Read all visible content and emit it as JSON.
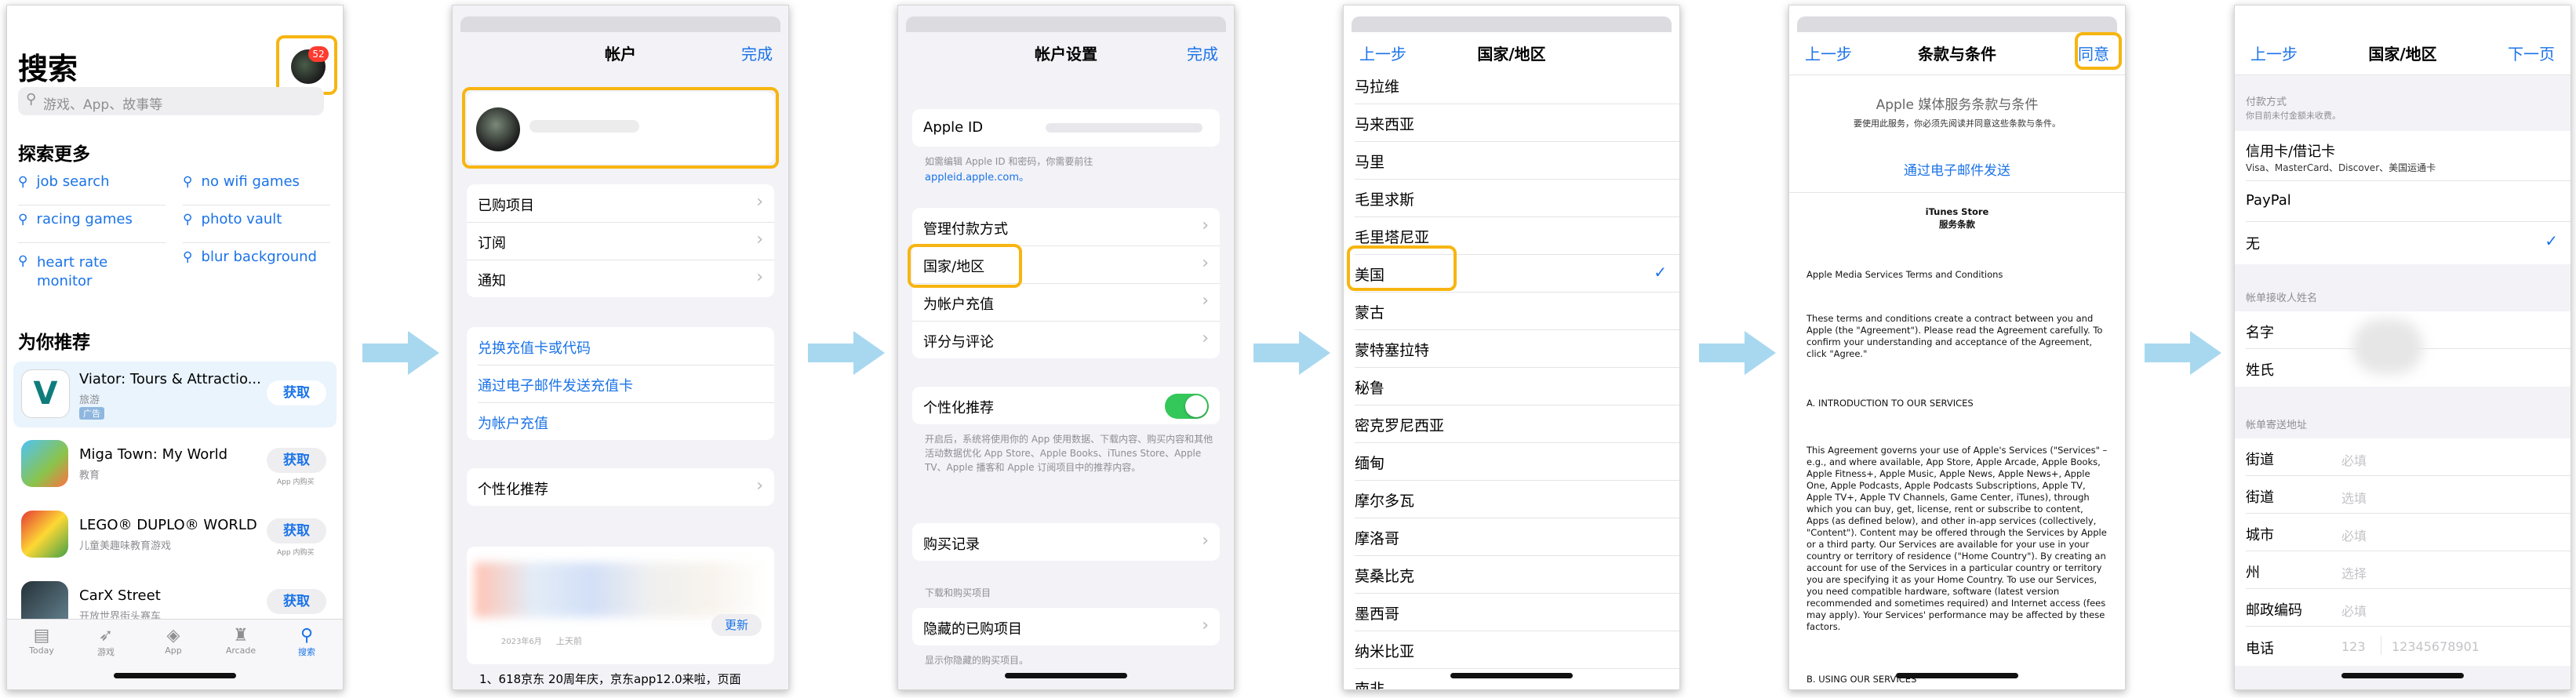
{
  "accent": "#1a73e8",
  "highlight": "#f7b511",
  "arrow_color": "#a8d8f0",
  "s1": {
    "title": "搜索",
    "badge": "52",
    "search_placeholder": "游戏、App、故事等",
    "explore_title": "探索更多",
    "explore": [
      "job search",
      "no wifi games",
      "racing games",
      "photo vault",
      "heart rate monitor",
      "blur background"
    ],
    "rec_title": "为你推荐",
    "apps": [
      {
        "name": "Viator: Tours & Attractio...",
        "cat": "旅游",
        "tag": "广告",
        "btn": "获取",
        "sub": ""
      },
      {
        "name": "Miga Town: My World",
        "cat": "教育",
        "tag": "",
        "btn": "获取",
        "sub": "App 内购买"
      },
      {
        "name": "LEGO® DUPLO® WORLD",
        "cat": "儿童美趣味教育游戏",
        "tag": "",
        "btn": "获取",
        "sub": "App 内购买"
      },
      {
        "name": "CarX Street",
        "cat": "开放世界街头赛车",
        "tag": "",
        "btn": "获取",
        "sub": "App 内购买"
      }
    ],
    "tabs": [
      "Today",
      "游戏",
      "App",
      "Arcade",
      "搜索"
    ]
  },
  "s2": {
    "title": "帐户",
    "done": "完成",
    "group1": [
      "已购项目",
      "订阅",
      "通知"
    ],
    "group2": [
      "兑换充值卡或代码",
      "通过电子邮件发送充值卡",
      "为帐户充值"
    ],
    "group3": [
      "个性化推荐"
    ],
    "update_date": "2023年6月",
    "update_ago": "上天前",
    "update_btn": "更新",
    "bottom_text": "1、618京东 20周年庆，京东app12.0来啦，页面"
  },
  "s3": {
    "title": "帐户设置",
    "done": "完成",
    "apple_id": "Apple ID",
    "apple_note": "如需编辑 Apple ID 和密码，你需要前往",
    "apple_link": "appleid.apple.com。",
    "g2": [
      "管理付款方式",
      "国家/地区",
      "为帐户充值",
      "评分与评论"
    ],
    "personal": "个性化推荐",
    "personal_note": "开启后，系统将使用你的 App 使用数据、下载内容、购买内容和其他活动数据优化 App Store、Apple Books、iTunes Store、Apple TV、Apple 播客和 Apple 订阅项目中的推荐内容。",
    "purchase": "购买记录",
    "dl_header": "下载和购买项目",
    "hidden": "隐藏的已购项目",
    "hidden_note": "显示你隐藏的购买项目。"
  },
  "s4": {
    "back": "上一步",
    "title": "国家/地区",
    "countries": [
      "马拉维",
      "马来西亚",
      "马里",
      "毛里求斯",
      "毛里塔尼亚",
      "美国",
      "蒙古",
      "蒙特塞拉特",
      "秘鲁",
      "密克罗尼西亚",
      "缅甸",
      "摩尔多瓦",
      "摩洛哥",
      "莫桑比克",
      "墨西哥",
      "纳米比亚",
      "南非"
    ],
    "selected": "美国"
  },
  "s5": {
    "back": "上一步",
    "title": "条款与条件",
    "agree": "同意",
    "heading": "Apple 媒体服务条款与条件",
    "sub": "要使用此服务，你必须先阅读并同意这些条款与条件。",
    "email_link": "通过电子邮件发送",
    "store_title": "iTunes Store",
    "store_sub": "服务条款",
    "p1": "Apple Media Services Terms and Conditions",
    "p2": "These terms and conditions create a contract between you and Apple (the \"Agreement\"). Please read the Agreement carefully. To confirm your understanding and acceptance of the Agreement, click \"Agree.\"",
    "p3": "A. INTRODUCTION TO OUR SERVICES",
    "p4": "This Agreement governs your use of Apple's Services (\"Services\" – e.g., and where available, App Store, Apple Arcade, Apple Books, Apple Fitness+, Apple Music, Apple News, Apple News+, Apple One, Apple Podcasts, Apple Podcasts Subscriptions, Apple TV, Apple TV+, Apple TV Channels, Game Center, iTunes), through which you can buy, get, license, rent or subscribe to content, Apps (as defined below), and other in-app services (collectively, \"Content\"). Content may be offered through the Services by Apple or a third party. Our Services are available for your use in your country or territory of residence (\"Home Country\"). By creating an account for use of the Services in a particular country or territory you are specifying it as your Home Country. To use our Services, you need compatible hardware, software (latest version recommended and sometimes required) and Internet access (fees may apply). Your Services' performance may be affected by these factors.",
    "p5": "B. USING OUR SERVICES"
  },
  "s6": {
    "back": "上一步",
    "title": "国家/地区",
    "next": "下一页",
    "pay_header": "付款方式",
    "pay_note": "你目前未付金额未收费。",
    "card": "信用卡/借记卡",
    "card_sub": "Visa、MasterCard、Discover、美国运通卡",
    "paypal": "PayPal",
    "none": "无",
    "name_header": "帐单接收人姓名",
    "first": "名字",
    "last": "姓氏",
    "addr_header": "帐单寄送地址",
    "fields": [
      {
        "label": "街道",
        "ph": "必填"
      },
      {
        "label": "街道",
        "ph": "选填"
      },
      {
        "label": "城市",
        "ph": "必填"
      },
      {
        "label": "州",
        "ph": "选择"
      },
      {
        "label": "邮政编码",
        "ph": "必填"
      }
    ],
    "phone": "电话",
    "phone_code": "123",
    "phone_ph": "12345678901"
  }
}
